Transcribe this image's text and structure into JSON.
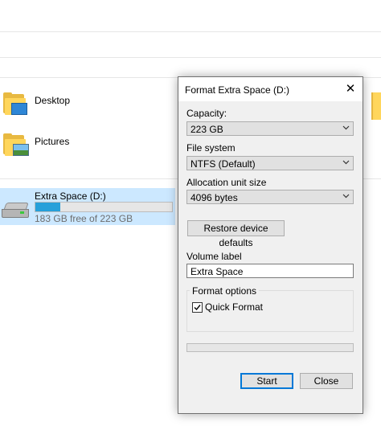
{
  "explorer": {
    "folders": [
      {
        "label": "Desktop",
        "icon": "desktop-folder-icon"
      },
      {
        "label": "Pictures",
        "icon": "pictures-folder-icon"
      }
    ],
    "drive": {
      "label": "Extra Space (D:)",
      "free_text": "183 GB free of 223 GB",
      "used_fraction": 0.18,
      "icon": "drive-icon"
    }
  },
  "dialog": {
    "title": "Format Extra Space (D:)",
    "close_glyph": "✕",
    "capacity": {
      "label": "Capacity:",
      "value": "223 GB"
    },
    "file_system": {
      "label": "File system",
      "value": "NTFS (Default)"
    },
    "allocation": {
      "label": "Allocation unit size",
      "value": "4096 bytes"
    },
    "restore_label": "Restore device defaults",
    "volume_label": {
      "label": "Volume label",
      "value": "Extra Space"
    },
    "format_options": {
      "title": "Format options",
      "quick_format": {
        "label": "Quick Format",
        "checked": true
      }
    },
    "progress_fraction": 0,
    "start_label": "Start",
    "close_label": "Close"
  },
  "colors": {
    "selection": "#cce8ff",
    "drive_bar": "#26a0da",
    "accent": "#0078d7"
  }
}
